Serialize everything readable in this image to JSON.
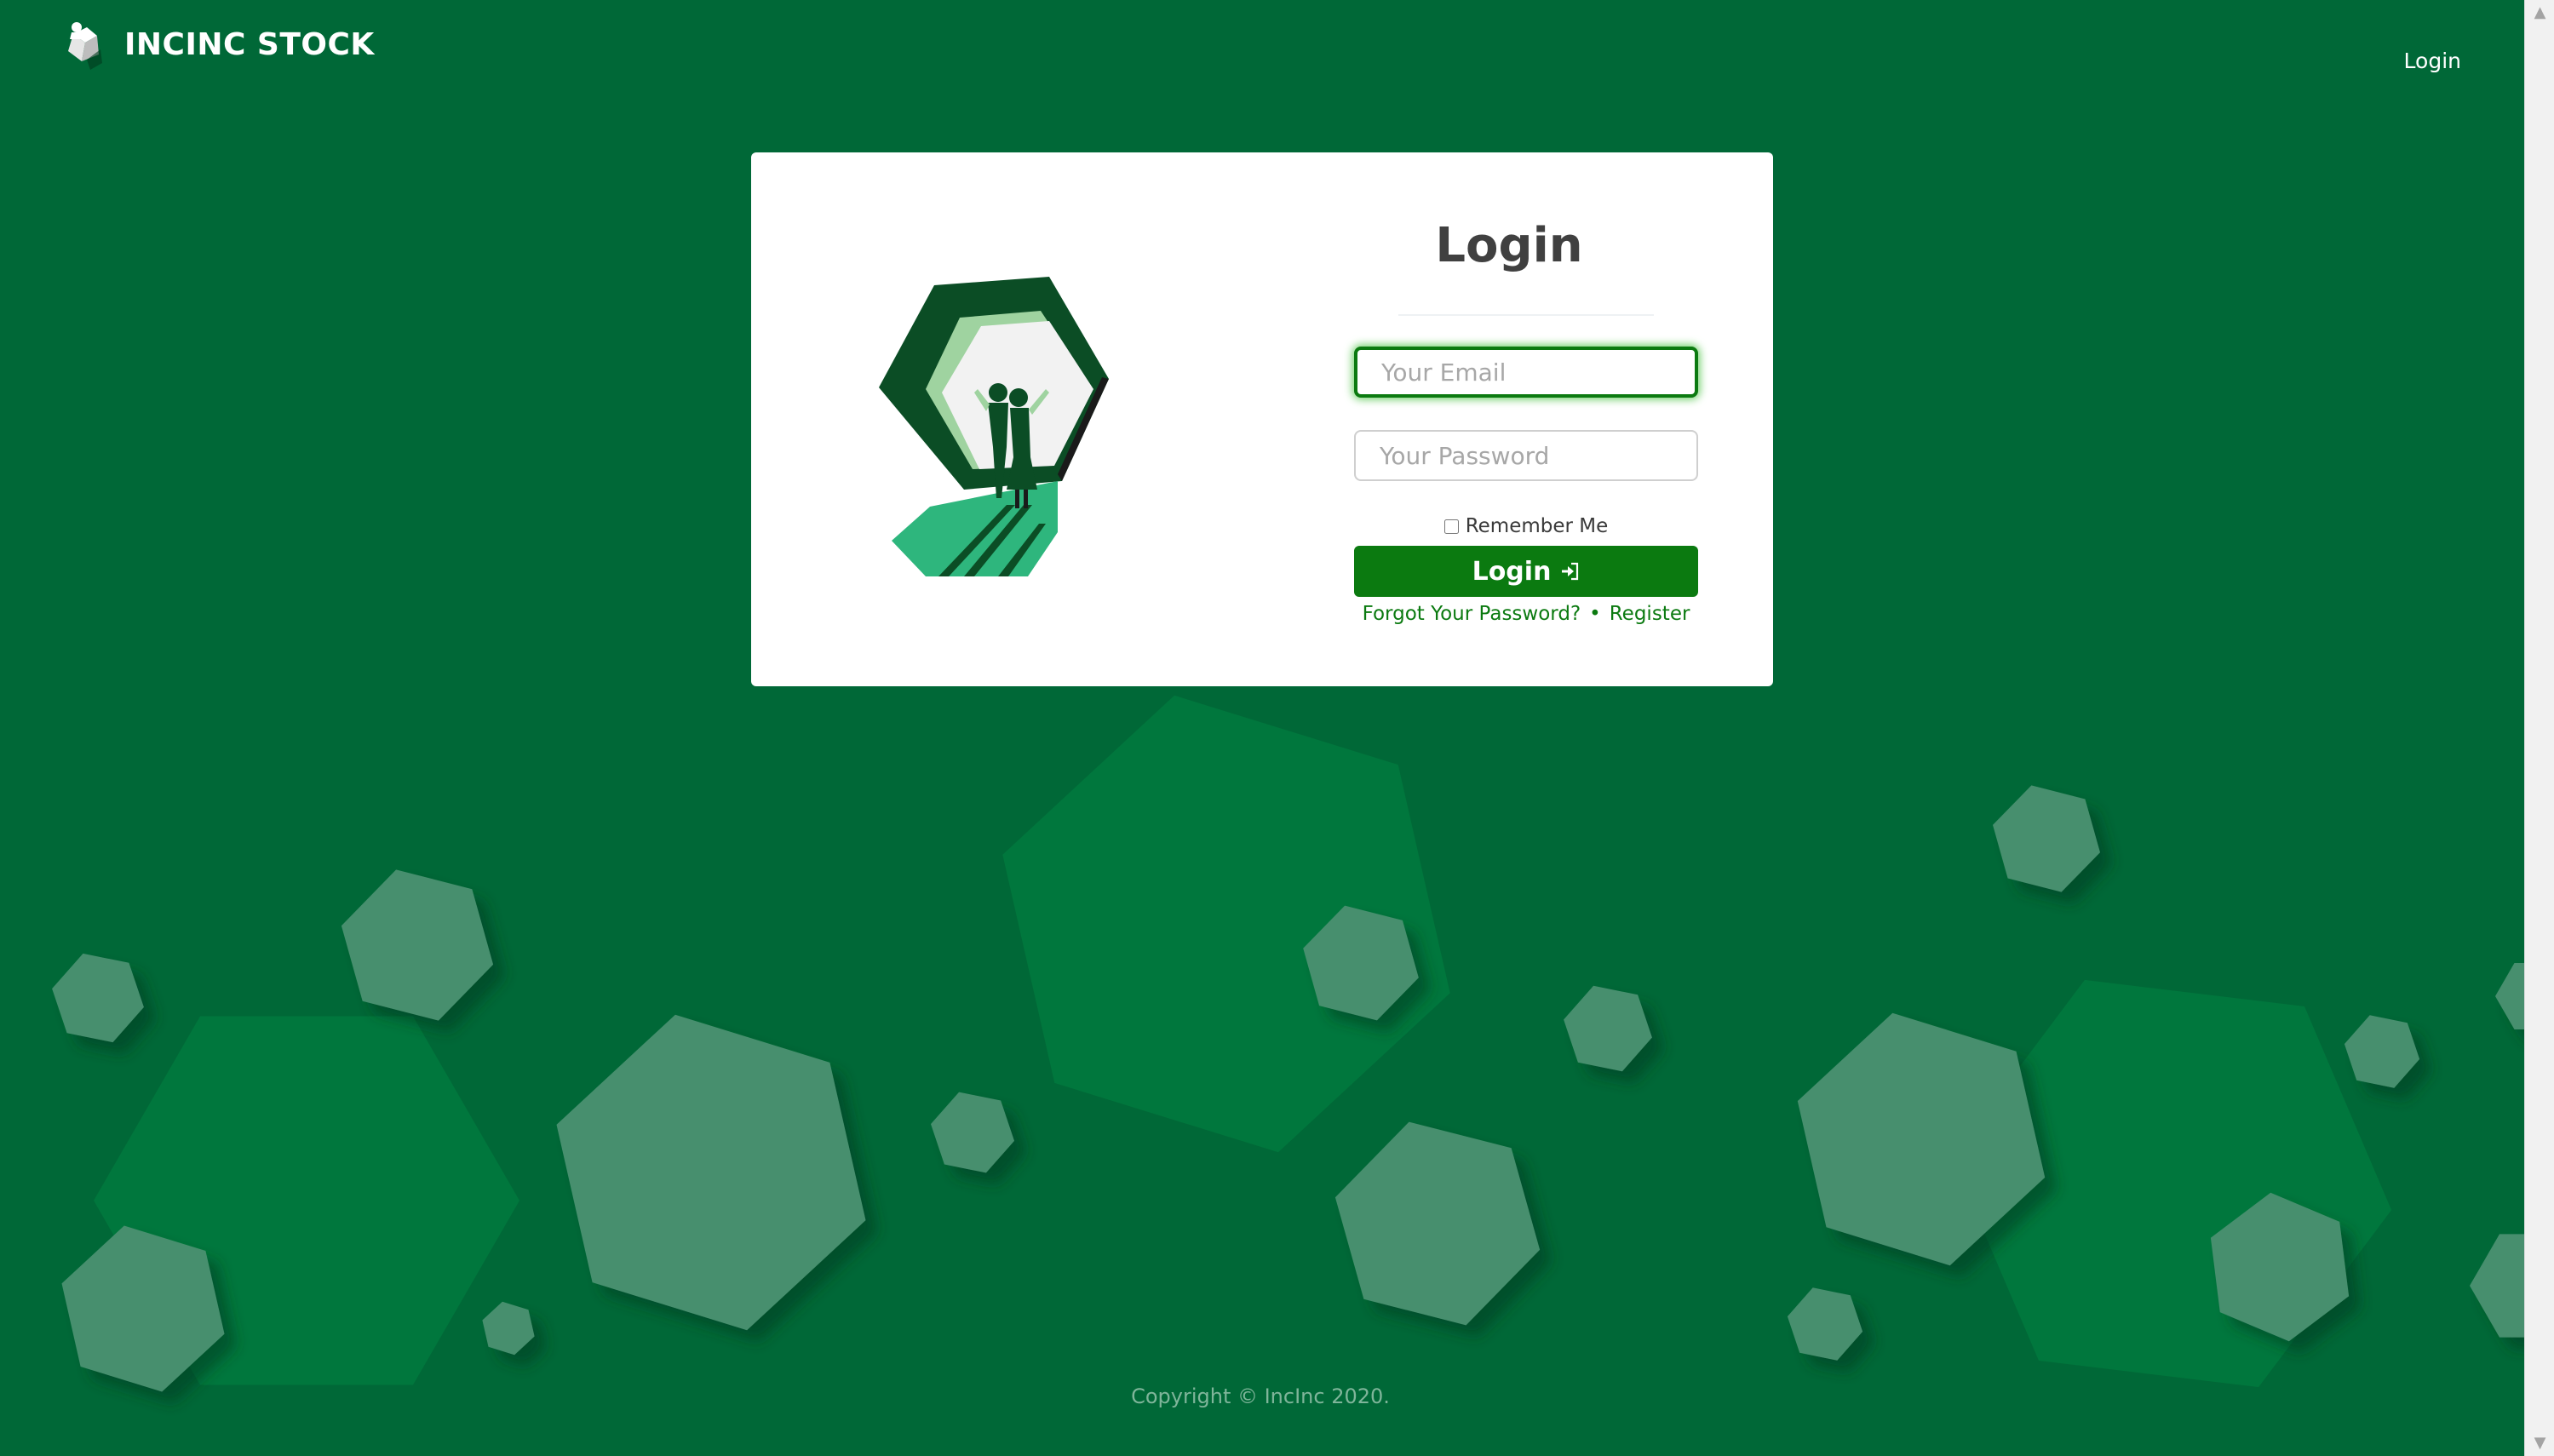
{
  "brand": {
    "name": "INCINC STOCK",
    "logo_icon": "incinc-logo-icon"
  },
  "nav": {
    "login_label": "Login"
  },
  "card": {
    "title": "Login",
    "illustration_icon": "hexagon-door-people-illustration",
    "email_placeholder": "Your Email",
    "email_value": "",
    "password_placeholder": "Your Password",
    "password_value": "",
    "remember_label": "Remember Me",
    "remember_checked": false,
    "login_button_label": "Login",
    "login_button_icon": "sign-in-icon",
    "forgot_label": "Forgot Your Password?",
    "separator": "•",
    "register_label": "Register"
  },
  "footer": {
    "copyright": "Copyright © IncInc 2020."
  },
  "colors": {
    "background": "#006837",
    "accent": "#0b7a10",
    "card": "#ffffff",
    "hex_light": "#478f6e",
    "hex_dark": "#00773d"
  }
}
